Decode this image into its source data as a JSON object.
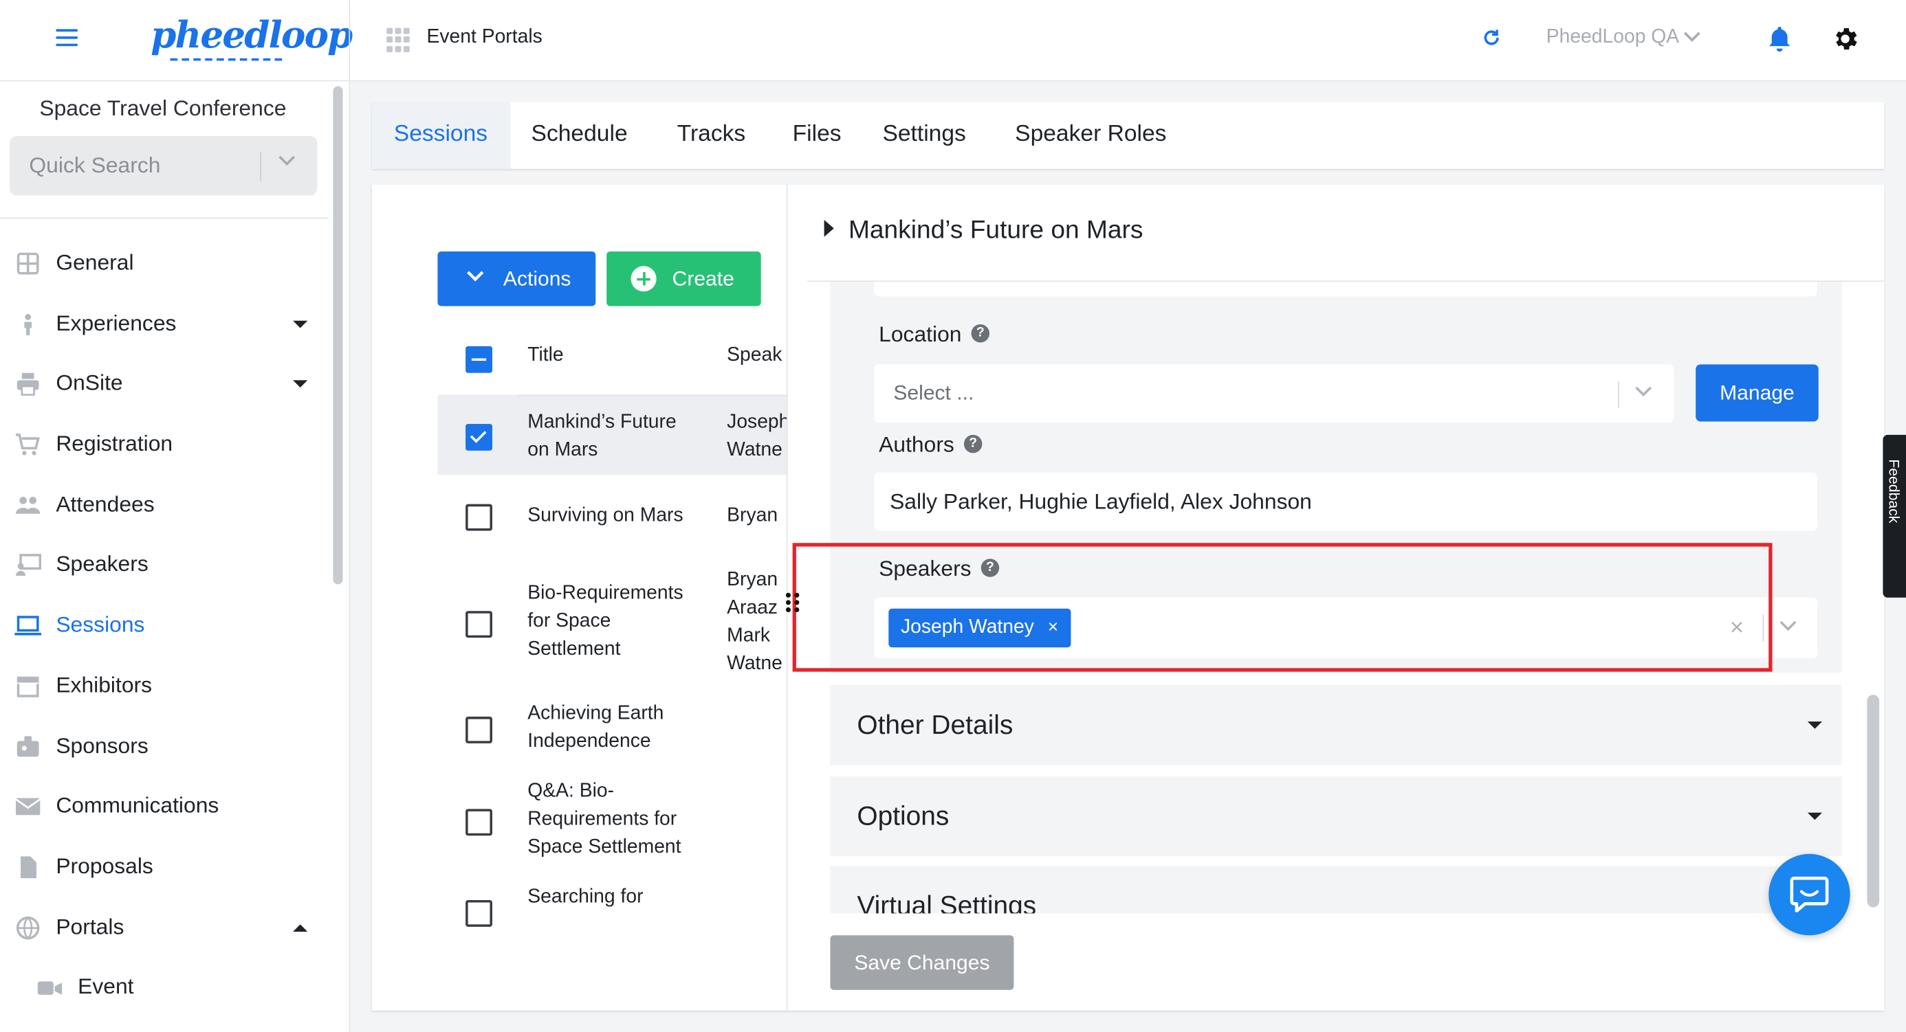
{
  "header": {
    "logo_text": "pheedloop",
    "title": "Event Portals",
    "org_name": "PheedLoop QA",
    "accent_color": "#1a73e8"
  },
  "sidebar": {
    "event_name": "Space Travel Conference",
    "search_placeholder": "Quick Search",
    "items": [
      {
        "label": "General",
        "icon": "grid-icon"
      },
      {
        "label": "Experiences",
        "icon": "person-icon"
      },
      {
        "label": "OnSite",
        "icon": "printer-icon"
      },
      {
        "label": "Registration",
        "icon": "cart-icon"
      },
      {
        "label": "Attendees",
        "icon": "people-icon"
      },
      {
        "label": "Speakers",
        "icon": "presenter-icon"
      },
      {
        "label": "Sessions",
        "icon": "laptop-icon",
        "active": true
      },
      {
        "label": "Exhibitors",
        "icon": "store-icon"
      },
      {
        "label": "Sponsors",
        "icon": "badge-icon"
      },
      {
        "label": "Communications",
        "icon": "mail-icon"
      },
      {
        "label": "Proposals",
        "icon": "document-icon"
      },
      {
        "label": "Portals",
        "icon": "globe-icon"
      },
      {
        "label": "Event",
        "icon": "video-icon"
      }
    ]
  },
  "tabs": [
    "Sessions",
    "Schedule",
    "Tracks",
    "Files",
    "Settings",
    "Speaker Roles"
  ],
  "list": {
    "actions_label": "Actions",
    "create_label": "Create",
    "col_title": "Title",
    "col_speakers": "Speak",
    "rows": [
      {
        "title": "Mankind’s Future on Mars",
        "title_lines": [
          "Mankind’s Future",
          "on Mars"
        ],
        "speakers": [
          "Joseph",
          "Watne"
        ],
        "checked": true
      },
      {
        "title": "Surviving on Mars",
        "title_lines": [
          "Surviving on Mars"
        ],
        "speakers": [
          "Bryan"
        ],
        "checked": false
      },
      {
        "title": "Bio-Requirements for Space Settlement",
        "title_lines": [
          "Bio-Requirements",
          "for Space",
          "Settlement"
        ],
        "speakers": [
          "Bryan",
          "Araaz",
          "Mark",
          "Watne"
        ],
        "checked": false
      },
      {
        "title": "Achieving Earth Independence",
        "title_lines": [
          "Achieving Earth",
          "Independence"
        ],
        "speakers": [],
        "checked": false
      },
      {
        "title": "Q&A: Bio-Requirements for Space Settlement",
        "title_lines": [
          "Q&A: Bio-",
          "Requirements for",
          "Space Settlement"
        ],
        "speakers": [],
        "checked": false
      },
      {
        "title": "Searching for",
        "title_lines": [
          "Searching for"
        ],
        "speakers": [],
        "checked": false
      }
    ]
  },
  "detail": {
    "session_title": "Mankind’s Future on Mars",
    "location_label": "Location",
    "location_placeholder": "Select ...",
    "manage_label": "Manage",
    "authors_label": "Authors",
    "authors_value": "Sally Parker, Hughie Layfield, Alex Johnson",
    "speakers_label": "Speakers",
    "speakers": [
      "Joseph Watney"
    ],
    "chip_remove": "×",
    "clear_all": "×",
    "sections": [
      "Other Details",
      "Options",
      "Virtual Settings"
    ],
    "save_label": "Save Changes",
    "help_glyph": "?"
  },
  "feedback_label": "Feedback"
}
